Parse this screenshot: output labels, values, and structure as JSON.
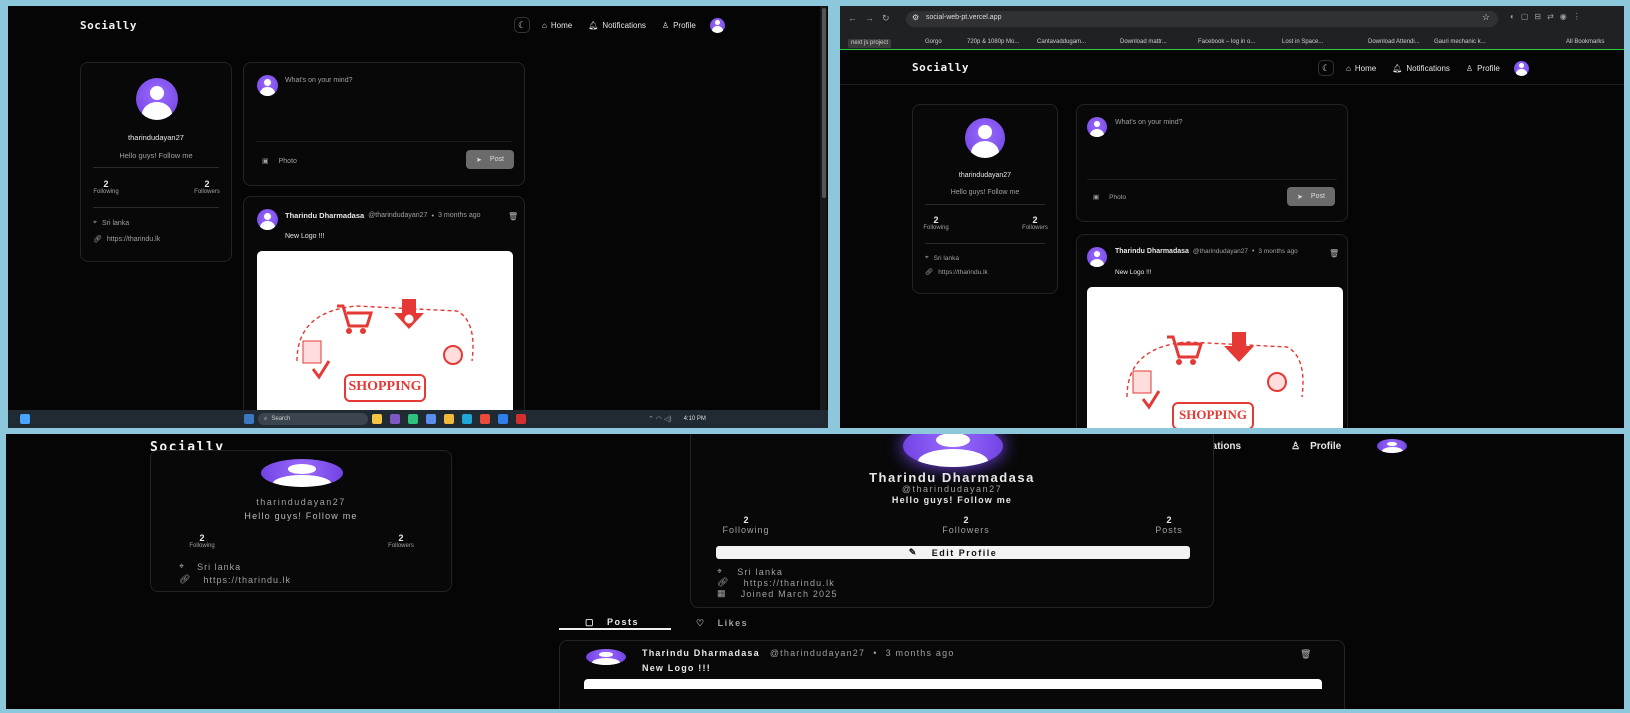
{
  "app": {
    "brand": "Socially"
  },
  "nav": {
    "home": "Home",
    "notifications": "Notifications",
    "profile": "Profile"
  },
  "user": {
    "username": "tharindudayan27",
    "bio": "Hello guys! Follow me",
    "following_count": "2",
    "following_label": "Following",
    "followers_count": "2",
    "followers_label": "Followers",
    "location": "Sri lanka",
    "website": "https://tharindu.lk"
  },
  "composer": {
    "placeholder": "What's on your mind?",
    "photo_label": "Photo",
    "post_label": "Post"
  },
  "post": {
    "author_name": "Tharindu Dharmadasa",
    "author_handle": "@tharindudayan27",
    "separator": "•",
    "time": "3 months ago",
    "content": "New Logo !!!",
    "image_text": "SHOPPING"
  },
  "browser": {
    "url": "social-web-pt.vercel.app",
    "bookmarks": [
      "next js project",
      "Gorgo",
      "720p & 1080p Mo...",
      "Cantavaddugam...",
      "Download mattr...",
      "Facebook – log in o...",
      "Lost in Space...",
      "Download Attendi...",
      "Gauri mechanic k..."
    ],
    "all_bookmarks": "All Bookmarks"
  },
  "taskbar": {
    "search": "Search",
    "time": "4:10 PM"
  },
  "profile_page": {
    "full_name": "Tharindu Dharmadasa",
    "handle": "@tharindudayan27",
    "bio": "Hello guys! Follow me",
    "following_count": "2",
    "following_label": "Following",
    "followers_count": "2",
    "followers_label": "Followers",
    "posts_count": "2",
    "posts_label": "Posts",
    "edit_profile": "Edit Profile",
    "location": "Sri lanka",
    "website": "https://tharindu.lk",
    "joined": "Joined March 2025",
    "tab_posts": "Posts",
    "tab_likes": "Likes",
    "post_author": "Tharindu Dharmadasa",
    "post_handle": "@tharindudayan27",
    "post_time": "3 months ago",
    "post_content": "New Logo !!!"
  },
  "colors": {
    "background": "#050505",
    "accent": "#7c4dff",
    "frame": "#8cc7dc"
  }
}
